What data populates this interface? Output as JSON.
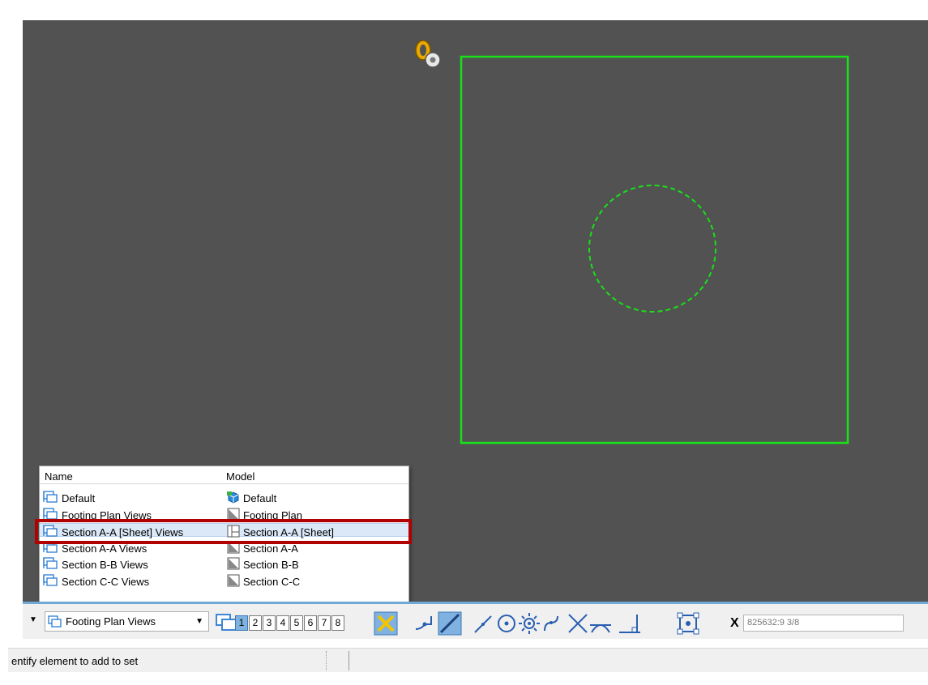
{
  "model_list": {
    "headers": {
      "name": "Name",
      "model": "Model"
    },
    "rows": [
      {
        "name": "Default",
        "model": "Default",
        "model_icon": "3d-model-icon",
        "selected": false
      },
      {
        "name": "Footing Plan Views",
        "model": "Footing Plan",
        "model_icon": "drawing-model-icon",
        "selected": false
      },
      {
        "name": "Section A-A [Sheet] Views",
        "model": "Section A-A [Sheet]",
        "model_icon": "sheet-model-icon",
        "selected": true
      },
      {
        "name": "Section A-A Views",
        "model": "Section A-A",
        "model_icon": "drawing-model-icon",
        "selected": false
      },
      {
        "name": "Section B-B Views",
        "model": "Section B-B",
        "model_icon": "drawing-model-icon",
        "selected": false
      },
      {
        "name": "Section C-C Views",
        "model": "Section C-C",
        "model_icon": "drawing-model-icon",
        "selected": false
      }
    ]
  },
  "toolbar": {
    "view_group": "Footing Plan Views",
    "view_numbers": [
      "1",
      "2",
      "3",
      "4",
      "5",
      "6",
      "7",
      "8"
    ],
    "active_view": "1",
    "coord_label": "X",
    "coord_value": "825632:9 3/8",
    "snap_icons": [
      "keypoint-snap-icon",
      "nearest-snap-icon",
      "midpoint-snap-icon",
      "center-snap-icon",
      "origin-snap-icon",
      "bisector-snap-icon",
      "intersection-snap-icon",
      "tangent-snap-icon",
      "perpendicular-snap-icon",
      "snap-settings-icon"
    ]
  },
  "status": {
    "prompt": "entify element to add to set"
  },
  "colors": {
    "viewport_bg": "#525252",
    "element_green": "#18e018",
    "highlight_red": "#b00000",
    "toolbar_accent": "#6fa9d6"
  }
}
